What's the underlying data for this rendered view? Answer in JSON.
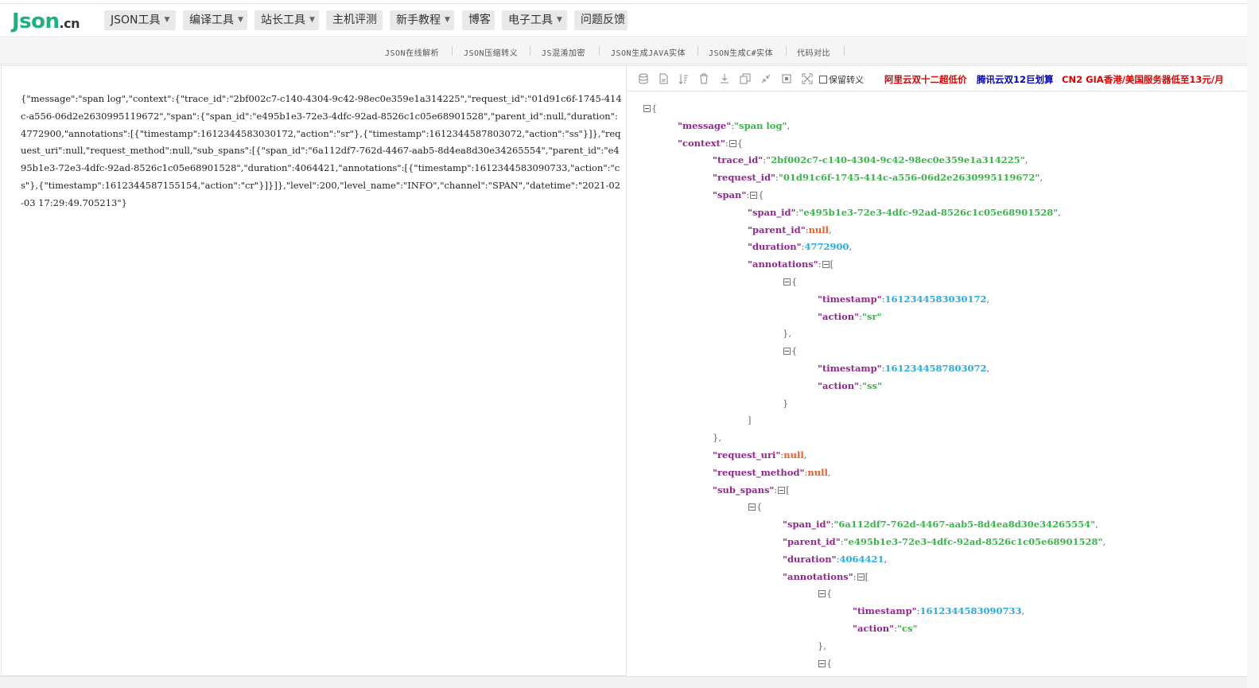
{
  "logo": {
    "main": "Json",
    "suffix": ".cn"
  },
  "nav": [
    {
      "label": "JSON工具",
      "caret": "▼"
    },
    {
      "label": "编译工具",
      "caret": "▼"
    },
    {
      "label": "站长工具",
      "caret": "▼"
    },
    {
      "label": "主机评测"
    },
    {
      "label": "新手教程",
      "caret": "▼"
    },
    {
      "label": "博客"
    },
    {
      "label": "电子工具",
      "caret": "▼"
    },
    {
      "label": "问题反馈"
    }
  ],
  "sublinks": [
    "JSON在线解析",
    "JSON压缩转义",
    "JS混淆加密",
    "JSON生成JAVA实体",
    "JSON生成C#实体",
    "代码对比"
  ],
  "raw_json": "{\"message\":\"span log\",\"context\":{\"trace_id\":\"2bf002c7-c140-4304-9c42-98ec0e359e1a314225\",\"request_id\":\"01d91c6f-1745-414c-a556-06d2e2630995119672\",\"span\":{\"span_id\":\"e495b1e3-72e3-4dfc-92ad-8526c1c05e68901528\",\"parent_id\":null,\"duration\":4772900,\"annotations\":[{\"timestamp\":1612344583030172,\"action\":\"sr\"},{\"timestamp\":1612344587803072,\"action\":\"ss\"}]},\"request_uri\":null,\"request_method\":null,\"sub_spans\":[{\"span_id\":\"6a112df7-762d-4467-aab5-8d4ea8d30e34265554\",\"parent_id\":\"e495b1e3-72e3-4dfc-92ad-8526c1c05e68901528\",\"duration\":4064421,\"annotations\":[{\"timestamp\":1612344583090733,\"action\":\"cs\"},{\"timestamp\":1612344587155154,\"action\":\"cr\"}]}]},\"level\":200,\"level_name\":\"INFO\",\"channel\":\"SPAN\",\"datetime\":\"2021-02-03 17:29:49.705213\"}",
  "toolbar": {
    "tools": [
      "database-icon",
      "file-icon",
      "sort-icon",
      "trash-icon",
      "download-icon",
      "copy-icon",
      "compress-icon",
      "expand-icon",
      "fullscreen-icon"
    ],
    "checkbox_label": "保留转义",
    "ads": [
      {
        "label": "阿里云双十二超低价",
        "color": "#e00000"
      },
      {
        "label": "腾讯云双12巨划算",
        "color": "#0000cc"
      },
      {
        "label": "CN2 GIA香港/美国服务器低至13元/月",
        "color": "#e00000"
      }
    ]
  },
  "tree": [
    {
      "i": 0,
      "parts": [
        [
          "tg",
          ""
        ],
        [
          "p",
          "{"
        ]
      ]
    },
    {
      "i": 1,
      "parts": [
        [
          "k",
          "\"message\""
        ],
        [
          "p",
          ":"
        ],
        [
          "s",
          "\"span log\""
        ],
        [
          "p",
          ","
        ]
      ]
    },
    {
      "i": 1,
      "parts": [
        [
          "k",
          "\"context\""
        ],
        [
          "p",
          ":"
        ],
        [
          "tg",
          ""
        ],
        [
          "p",
          "{"
        ]
      ]
    },
    {
      "i": 2,
      "parts": [
        [
          "k",
          "\"trace_id\""
        ],
        [
          "p",
          ":"
        ],
        [
          "s",
          "\"2bf002c7-c140-4304-9c42-98ec0e359e1a314225\""
        ],
        [
          "p",
          ","
        ]
      ]
    },
    {
      "i": 2,
      "parts": [
        [
          "k",
          "\"request_id\""
        ],
        [
          "p",
          ":"
        ],
        [
          "s",
          "\"01d91c6f-1745-414c-a556-06d2e2630995119672\""
        ],
        [
          "p",
          ","
        ]
      ]
    },
    {
      "i": 2,
      "parts": [
        [
          "k",
          "\"span\""
        ],
        [
          "p",
          ":"
        ],
        [
          "tg",
          ""
        ],
        [
          "p",
          "{"
        ]
      ]
    },
    {
      "i": 3,
      "parts": [
        [
          "k",
          "\"span_id\""
        ],
        [
          "p",
          ":"
        ],
        [
          "s",
          "\"e495b1e3-72e3-4dfc-92ad-8526c1c05e68901528\""
        ],
        [
          "p",
          ","
        ]
      ]
    },
    {
      "i": 3,
      "parts": [
        [
          "k",
          "\"parent_id\""
        ],
        [
          "p",
          ":"
        ],
        [
          "nl",
          "null"
        ],
        [
          "p",
          ","
        ]
      ]
    },
    {
      "i": 3,
      "parts": [
        [
          "k",
          "\"duration\""
        ],
        [
          "p",
          ":"
        ],
        [
          "n",
          "4772900"
        ],
        [
          "p",
          ","
        ]
      ]
    },
    {
      "i": 3,
      "parts": [
        [
          "k",
          "\"annotations\""
        ],
        [
          "p",
          ":"
        ],
        [
          "tg",
          ""
        ],
        [
          "p",
          "["
        ]
      ]
    },
    {
      "i": 4,
      "parts": [
        [
          "tg",
          ""
        ],
        [
          "p",
          "{"
        ]
      ]
    },
    {
      "i": 5,
      "parts": [
        [
          "k",
          "\"timestamp\""
        ],
        [
          "p",
          ":"
        ],
        [
          "n",
          "1612344583030172"
        ],
        [
          "p",
          ","
        ]
      ]
    },
    {
      "i": 5,
      "parts": [
        [
          "k",
          "\"action\""
        ],
        [
          "p",
          ":"
        ],
        [
          "s",
          "\"sr\""
        ]
      ]
    },
    {
      "i": 4,
      "parts": [
        [
          "p",
          "},"
        ]
      ]
    },
    {
      "i": 4,
      "parts": [
        [
          "tg",
          ""
        ],
        [
          "p",
          "{"
        ]
      ]
    },
    {
      "i": 5,
      "parts": [
        [
          "k",
          "\"timestamp\""
        ],
        [
          "p",
          ":"
        ],
        [
          "n",
          "1612344587803072"
        ],
        [
          "p",
          ","
        ]
      ]
    },
    {
      "i": 5,
      "parts": [
        [
          "k",
          "\"action\""
        ],
        [
          "p",
          ":"
        ],
        [
          "s",
          "\"ss\""
        ]
      ]
    },
    {
      "i": 4,
      "parts": [
        [
          "p",
          "}"
        ]
      ]
    },
    {
      "i": 3,
      "parts": [
        [
          "p",
          "]"
        ]
      ]
    },
    {
      "i": 2,
      "parts": [
        [
          "p",
          "},"
        ]
      ]
    },
    {
      "i": 2,
      "parts": [
        [
          "k",
          "\"request_uri\""
        ],
        [
          "p",
          ":"
        ],
        [
          "nl",
          "null"
        ],
        [
          "p",
          ","
        ]
      ]
    },
    {
      "i": 2,
      "parts": [
        [
          "k",
          "\"request_method\""
        ],
        [
          "p",
          ":"
        ],
        [
          "nl",
          "null"
        ],
        [
          "p",
          ","
        ]
      ]
    },
    {
      "i": 2,
      "parts": [
        [
          "k",
          "\"sub_spans\""
        ],
        [
          "p",
          ":"
        ],
        [
          "tg",
          ""
        ],
        [
          "p",
          "["
        ]
      ]
    },
    {
      "i": 3,
      "parts": [
        [
          "tg",
          ""
        ],
        [
          "p",
          "{"
        ]
      ]
    },
    {
      "i": 4,
      "parts": [
        [
          "k",
          "\"span_id\""
        ],
        [
          "p",
          ":"
        ],
        [
          "s",
          "\"6a112df7-762d-4467-aab5-8d4ea8d30e34265554\""
        ],
        [
          "p",
          ","
        ]
      ]
    },
    {
      "i": 4,
      "parts": [
        [
          "k",
          "\"parent_id\""
        ],
        [
          "p",
          ":"
        ],
        [
          "s",
          "\"e495b1e3-72e3-4dfc-92ad-8526c1c05e68901528\""
        ],
        [
          "p",
          ","
        ]
      ]
    },
    {
      "i": 4,
      "parts": [
        [
          "k",
          "\"duration\""
        ],
        [
          "p",
          ":"
        ],
        [
          "n",
          "4064421"
        ],
        [
          "p",
          ","
        ]
      ]
    },
    {
      "i": 4,
      "parts": [
        [
          "k",
          "\"annotations\""
        ],
        [
          "p",
          ":"
        ],
        [
          "tg",
          ""
        ],
        [
          "p",
          "["
        ]
      ]
    },
    {
      "i": 5,
      "parts": [
        [
          "tg",
          ""
        ],
        [
          "p",
          "{"
        ]
      ]
    },
    {
      "i": 6,
      "parts": [
        [
          "k",
          "\"timestamp\""
        ],
        [
          "p",
          ":"
        ],
        [
          "n",
          "1612344583090733"
        ],
        [
          "p",
          ","
        ]
      ]
    },
    {
      "i": 6,
      "parts": [
        [
          "k",
          "\"action\""
        ],
        [
          "p",
          ":"
        ],
        [
          "s",
          "\"cs\""
        ]
      ]
    },
    {
      "i": 5,
      "parts": [
        [
          "p",
          "},"
        ]
      ]
    },
    {
      "i": 5,
      "parts": [
        [
          "tg",
          ""
        ],
        [
          "p",
          "{"
        ]
      ]
    }
  ]
}
